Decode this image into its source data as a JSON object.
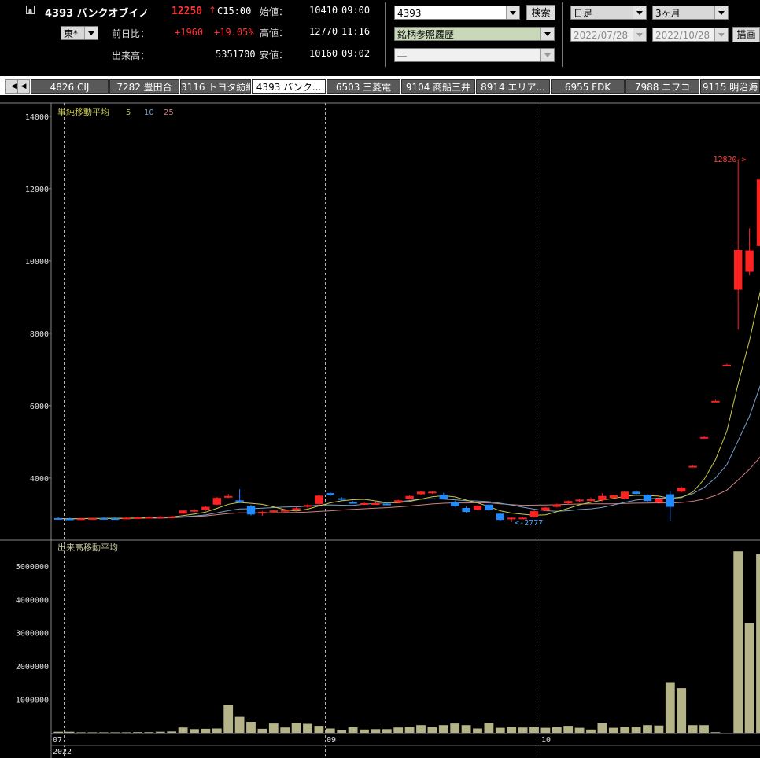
{
  "quote": {
    "code_name": "4393 バンクオブイノ",
    "price": "12250",
    "change_arrow": "↑",
    "close_time": "C15:00",
    "market": "東*",
    "change_label": "前日比：",
    "change": "+1960",
    "change_pct": "+19.05%",
    "volume_label": "出来高：",
    "volume": "5351700",
    "open_label": "始値：",
    "open": "10410",
    "open_time": "09:00",
    "high_label": "高値：",
    "high": "12770",
    "high_time": "11:16",
    "low_label": "安値：",
    "low": "10160",
    "low_time": "09:02"
  },
  "search": {
    "code": "4393",
    "button": "検索",
    "history": "銘柄参照履歴",
    "third": "―"
  },
  "period": {
    "bar": "日足",
    "range": "3ヶ月",
    "from": "2022/07/28",
    "to": "2022/10/28",
    "draw_button": "描画"
  },
  "tabs": [
    {
      "label": "4826 CIJ",
      "active": false
    },
    {
      "label": "7282 豊田合",
      "active": false
    },
    {
      "label": "3116 トヨタ紡織",
      "active": false
    },
    {
      "label": "4393 バンク...",
      "active": true
    },
    {
      "label": "6503 三菱電",
      "active": false
    },
    {
      "label": "9104 商船三井",
      "active": false
    },
    {
      "label": "8914 エリア...",
      "active": false
    },
    {
      "label": "6955 FDK",
      "active": false
    },
    {
      "label": "7988 ニフコ",
      "active": false
    },
    {
      "label": "9115 明治海",
      "active": false
    }
  ],
  "colors": {
    "up": "#ff2020",
    "down": "#1e8cff",
    "ma5": "#c8c850",
    "ma10": "#7aa0c8",
    "ma25": "#d08080",
    "volume_bar": "#b4b488",
    "grid": "#b0b0b0"
  },
  "chart_data": [
    {
      "type": "candlestick",
      "title": "単純移動平均",
      "legend": [
        {
          "label": "5",
          "color": "#c8c850"
        },
        {
          "label": "10",
          "color": "#7aa0c8"
        },
        {
          "label": "25",
          "color": "#d08080"
        }
      ],
      "y_ticks": [
        4000,
        6000,
        8000,
        10000,
        12000,
        14000
      ],
      "ylim": [
        2300,
        14300
      ],
      "annotations": [
        {
          "text": "12820->",
          "x": "2022/10/27",
          "y": 12820
        },
        {
          "text": "<-2777",
          "x": "2022/09/27",
          "y": 2777
        }
      ],
      "candles": [
        {
          "x": "2022/07/28",
          "o": 2890,
          "h": 2910,
          "l": 2855,
          "c": 2875
        },
        {
          "x": "2022/07/29",
          "o": 2875,
          "h": 2900,
          "l": 2850,
          "c": 2870
        },
        {
          "x": "2022/08/01",
          "o": 2870,
          "h": 2895,
          "l": 2855,
          "c": 2880
        },
        {
          "x": "2022/08/02",
          "o": 2880,
          "h": 2900,
          "l": 2865,
          "c": 2890
        },
        {
          "x": "2022/08/03",
          "o": 2890,
          "h": 2910,
          "l": 2870,
          "c": 2885
        },
        {
          "x": "2022/08/04",
          "o": 2885,
          "h": 2905,
          "l": 2870,
          "c": 2880
        },
        {
          "x": "2022/08/05",
          "o": 2880,
          "h": 2915,
          "l": 2860,
          "c": 2900
        },
        {
          "x": "2022/08/08",
          "o": 2900,
          "h": 2925,
          "l": 2880,
          "c": 2910
        },
        {
          "x": "2022/08/09",
          "o": 2910,
          "h": 2935,
          "l": 2890,
          "c": 2920
        },
        {
          "x": "2022/08/10",
          "o": 2920,
          "h": 2950,
          "l": 2900,
          "c": 2930
        },
        {
          "x": "2022/08/12",
          "o": 2930,
          "h": 2955,
          "l": 2910,
          "c": 2935
        },
        {
          "x": "2022/08/15",
          "o": 3010,
          "h": 3120,
          "l": 2990,
          "c": 3100
        },
        {
          "x": "2022/08/16",
          "o": 3090,
          "h": 3140,
          "l": 3060,
          "c": 3110
        },
        {
          "x": "2022/08/17",
          "o": 3120,
          "h": 3220,
          "l": 3090,
          "c": 3200
        },
        {
          "x": "2022/08/18",
          "o": 3260,
          "h": 3480,
          "l": 3250,
          "c": 3450
        },
        {
          "x": "2022/08/19",
          "o": 3480,
          "h": 3560,
          "l": 3440,
          "c": 3500
        },
        {
          "x": "2022/08/22",
          "o": 3380,
          "h": 3690,
          "l": 3300,
          "c": 3350
        },
        {
          "x": "2022/08/23",
          "o": 3220,
          "h": 3260,
          "l": 2960,
          "c": 2990
        },
        {
          "x": "2022/08/24",
          "o": 3040,
          "h": 3080,
          "l": 2950,
          "c": 3060
        },
        {
          "x": "2022/08/25",
          "o": 3080,
          "h": 3120,
          "l": 3050,
          "c": 3100
        },
        {
          "x": "2022/08/26",
          "o": 3100,
          "h": 3140,
          "l": 3060,
          "c": 3110
        },
        {
          "x": "2022/08/29",
          "o": 3140,
          "h": 3200,
          "l": 3110,
          "c": 3160
        },
        {
          "x": "2022/08/30",
          "o": 3200,
          "h": 3280,
          "l": 3160,
          "c": 3250
        },
        {
          "x": "2022/08/31",
          "o": 3280,
          "h": 3530,
          "l": 3250,
          "c": 3510
        },
        {
          "x": "2022/09/01",
          "o": 3580,
          "h": 3600,
          "l": 3500,
          "c": 3520
        },
        {
          "x": "2022/09/02",
          "o": 3440,
          "h": 3470,
          "l": 3380,
          "c": 3400
        },
        {
          "x": "2022/09/05",
          "o": 3330,
          "h": 3360,
          "l": 3290,
          "c": 3310
        },
        {
          "x": "2022/09/06",
          "o": 3300,
          "h": 3340,
          "l": 3280,
          "c": 3300
        },
        {
          "x": "2022/09/07",
          "o": 3300,
          "h": 3340,
          "l": 3270,
          "c": 3300
        },
        {
          "x": "2022/09/08",
          "o": 3290,
          "h": 3320,
          "l": 3260,
          "c": 3280
        },
        {
          "x": "2022/09/09",
          "o": 3320,
          "h": 3400,
          "l": 3300,
          "c": 3380
        },
        {
          "x": "2022/09/12",
          "o": 3420,
          "h": 3520,
          "l": 3400,
          "c": 3500
        },
        {
          "x": "2022/09/13",
          "o": 3550,
          "h": 3650,
          "l": 3530,
          "c": 3620
        },
        {
          "x": "2022/09/14",
          "o": 3580,
          "h": 3650,
          "l": 3560,
          "c": 3620
        },
        {
          "x": "2022/09/15",
          "o": 3540,
          "h": 3590,
          "l": 3410,
          "c": 3420
        },
        {
          "x": "2022/09/16",
          "o": 3330,
          "h": 3370,
          "l": 3200,
          "c": 3220
        },
        {
          "x": "2022/09/20",
          "o": 3170,
          "h": 3210,
          "l": 3040,
          "c": 3060
        },
        {
          "x": "2022/09/21",
          "o": 3120,
          "h": 3250,
          "l": 3100,
          "c": 3230
        },
        {
          "x": "2022/09/22",
          "o": 3260,
          "h": 3300,
          "l": 3090,
          "c": 3110
        },
        {
          "x": "2022/09/26",
          "o": 3010,
          "h": 3040,
          "l": 2820,
          "c": 2840
        },
        {
          "x": "2022/09/27",
          "o": 2880,
          "h": 2910,
          "l": 2777,
          "c": 2900
        },
        {
          "x": "2022/09/28",
          "o": 2880,
          "h": 2930,
          "l": 2860,
          "c": 2900
        },
        {
          "x": "2022/09/29",
          "o": 2920,
          "h": 3100,
          "l": 2900,
          "c": 3080
        },
        {
          "x": "2022/09/30",
          "o": 3100,
          "h": 3200,
          "l": 3080,
          "c": 3180
        },
        {
          "x": "2022/10/03",
          "o": 3200,
          "h": 3290,
          "l": 3180,
          "c": 3270
        },
        {
          "x": "2022/10/04",
          "o": 3300,
          "h": 3380,
          "l": 3270,
          "c": 3360
        },
        {
          "x": "2022/10/05",
          "o": 3360,
          "h": 3430,
          "l": 3330,
          "c": 3400
        },
        {
          "x": "2022/10/06",
          "o": 3380,
          "h": 3460,
          "l": 3350,
          "c": 3410
        },
        {
          "x": "2022/10/07",
          "o": 3390,
          "h": 3580,
          "l": 3350,
          "c": 3500
        },
        {
          "x": "2022/10/11",
          "o": 3450,
          "h": 3540,
          "l": 3430,
          "c": 3520
        },
        {
          "x": "2022/10/12",
          "o": 3430,
          "h": 3630,
          "l": 3400,
          "c": 3620
        },
        {
          "x": "2022/10/13",
          "o": 3620,
          "h": 3660,
          "l": 3540,
          "c": 3560
        },
        {
          "x": "2022/10/14",
          "o": 3530,
          "h": 3550,
          "l": 3350,
          "c": 3360
        },
        {
          "x": "2022/10/17",
          "o": 3320,
          "h": 3500,
          "l": 3290,
          "c": 3430
        },
        {
          "x": "2022/10/18",
          "o": 3550,
          "h": 3650,
          "l": 2800,
          "c": 3200
        },
        {
          "x": "2022/10/19",
          "o": 3620,
          "h": 3760,
          "l": 3600,
          "c": 3730
        },
        {
          "x": "2022/10/20",
          "o": 4330,
          "h": 4360,
          "l": 4330,
          "c": 4330
        },
        {
          "x": "2022/10/21",
          "o": 5130,
          "h": 5160,
          "l": 5130,
          "c": 5130
        },
        {
          "x": "2022/10/24",
          "o": 6130,
          "h": 6160,
          "l": 6130,
          "c": 6130
        },
        {
          "x": "2022/10/25",
          "o": 7130,
          "h": 7160,
          "l": 7130,
          "c": 7130
        },
        {
          "x": "2022/10/26",
          "o": 9200,
          "h": 12800,
          "l": 8100,
          "c": 10300
        },
        {
          "x": "2022/10/27",
          "o": 9700,
          "h": 10900,
          "l": 9600,
          "c": 10290
        },
        {
          "x": "2022/10/28",
          "o": 10410,
          "h": 12770,
          "l": 10160,
          "c": 12250
        }
      ]
    },
    {
      "type": "bar",
      "title": "出来高移動平均",
      "y_ticks": [
        1000000,
        2000000,
        3000000,
        4000000,
        5000000
      ],
      "ylim": [
        0,
        5750000
      ],
      "x_labels": [
        "07",
        "09",
        "10"
      ],
      "year_label": "2022",
      "values": [
        30000,
        30000,
        15000,
        15000,
        15000,
        15000,
        15000,
        20000,
        20000,
        30000,
        40000,
        160000,
        110000,
        120000,
        130000,
        840000,
        480000,
        330000,
        120000,
        280000,
        160000,
        300000,
        270000,
        210000,
        130000,
        70000,
        170000,
        100000,
        110000,
        110000,
        160000,
        180000,
        230000,
        170000,
        230000,
        280000,
        230000,
        130000,
        300000,
        150000,
        170000,
        160000,
        170000,
        150000,
        170000,
        210000,
        150000,
        100000,
        300000,
        150000,
        170000,
        180000,
        230000,
        220000,
        1520000,
        1340000,
        230000,
        230000,
        20000,
        0,
        5440000,
        3300000,
        5351700
      ]
    }
  ]
}
